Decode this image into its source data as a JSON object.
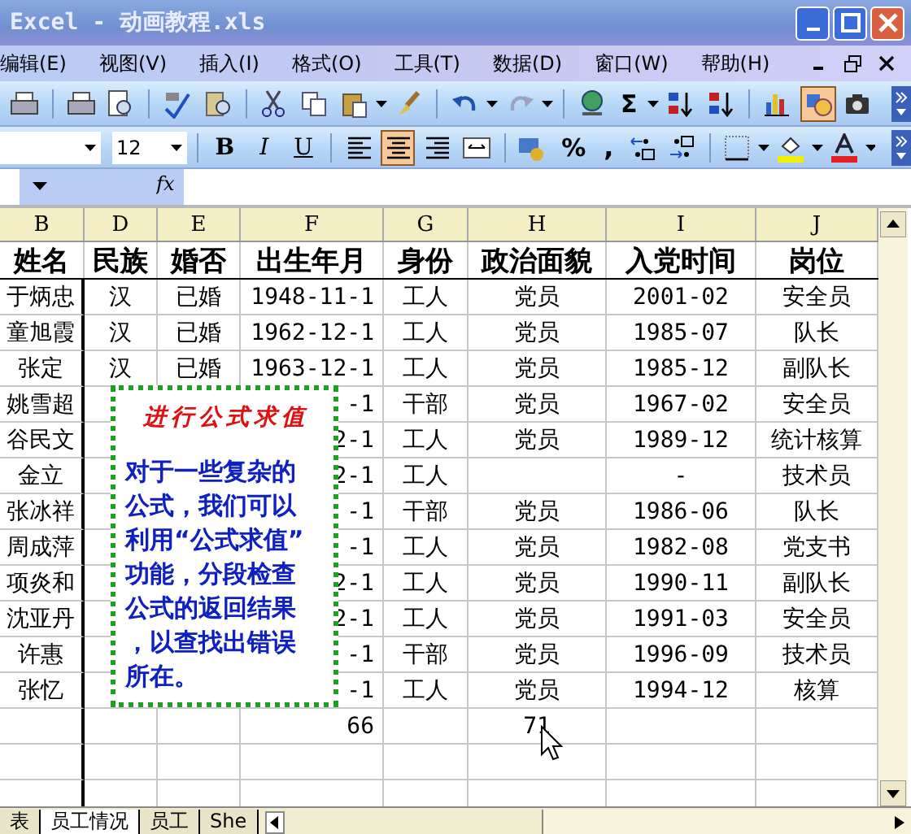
{
  "window": {
    "title": "Excel - 动画教程.xls"
  },
  "menu": [
    "编辑(E)",
    "视图(V)",
    "插入(I)",
    "格式(O)",
    "工具(T)",
    "数据(D)",
    "窗口(W)",
    "帮助(H)"
  ],
  "toolbar": {
    "sum_symbol": "Σ"
  },
  "format_bar": {
    "font_size": "12",
    "bold": "B",
    "italic": "I",
    "underline": "U",
    "percent": "%",
    "comma": ",",
    "align_buttons": [
      {
        "selected": false
      },
      {
        "selected": true
      },
      {
        "selected": false
      }
    ]
  },
  "formula_bar": {
    "fx": "fx"
  },
  "columns": [
    "B",
    "D",
    "E",
    "F",
    "G",
    "H",
    "I",
    "J"
  ],
  "table": {
    "headers": [
      "姓名",
      "民族",
      "婚否",
      "出生年月",
      "身份",
      "政治面貌",
      "入党时间",
      "岗位"
    ],
    "rows": [
      {
        "cells": [
          "于炳忠",
          "汉",
          "已婚",
          "1948-11-1",
          "工人",
          "党员",
          "2001-02",
          "安全员"
        ]
      },
      {
        "cells": [
          "童旭霞",
          "汉",
          "已婚",
          "1962-12-1",
          "工人",
          "党员",
          "1985-07",
          "队长"
        ]
      },
      {
        "cells": [
          "张定",
          "汉",
          "已婚",
          "1963-12-1",
          "工人",
          "党员",
          "1985-12",
          "副队长"
        ]
      },
      {
        "cells": [
          "姚雪超",
          null,
          null,
          "-1",
          "干部",
          "党员",
          "1967-02",
          "安全员"
        ]
      },
      {
        "cells": [
          "谷民文",
          null,
          null,
          "2-1",
          "工人",
          "党员",
          "1989-12",
          "统计核算"
        ]
      },
      {
        "cells": [
          "金立",
          null,
          null,
          "2-1",
          "工人",
          null,
          "-",
          "技术员"
        ]
      },
      {
        "cells": [
          "张冰祥",
          null,
          null,
          "-1",
          "干部",
          "党员",
          "1986-06",
          "队长"
        ]
      },
      {
        "cells": [
          "周成萍",
          null,
          null,
          "-1",
          "工人",
          "党员",
          "1982-08",
          "党支书"
        ]
      },
      {
        "cells": [
          "项炎和",
          null,
          null,
          "2-1",
          "工人",
          "党员",
          "1990-11",
          "副队长"
        ]
      },
      {
        "cells": [
          "沈亚丹",
          null,
          null,
          "2-1",
          "工人",
          "党员",
          "1991-03",
          "安全员"
        ]
      },
      {
        "cells": [
          "许惠",
          null,
          null,
          "-1",
          "干部",
          "党员",
          "1996-09",
          "技术员"
        ]
      },
      {
        "cells": [
          "张忆",
          null,
          null,
          "-1",
          "工人",
          "党员",
          "1994-12",
          "核算"
        ]
      },
      {
        "cells": [
          null,
          null,
          null,
          "66",
          null,
          "71",
          null,
          null
        ]
      }
    ]
  },
  "comment_box": {
    "title": "进行公式求值",
    "body": "对于一些复杂的公式，我们可以利用“公式求值”功能，分段检查公式的返回结果，以查找出错误所在。"
  },
  "sheet_tabs": [
    {
      "label": "表",
      "selected": false
    },
    {
      "label": "员工情况",
      "selected": true
    },
    {
      "label": "员工",
      "selected": false
    },
    {
      "label": "She",
      "selected": false
    }
  ]
}
